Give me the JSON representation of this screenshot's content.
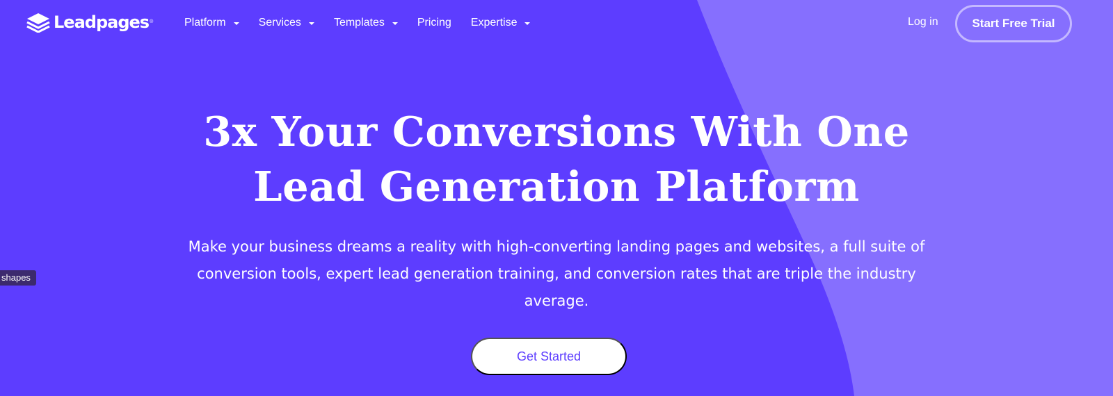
{
  "brand": {
    "name": "Leadpages",
    "registered_mark": "®",
    "logo_icon": "stacked-layers-icon"
  },
  "colors": {
    "background": "#5d3dff",
    "background_shape": "#866ffe",
    "text": "#ffffff",
    "trial_border": "#c4b8ff",
    "cta_background": "#ffffff",
    "cta_text": "#5d3dff",
    "tooltip_background": "#3c2a6e"
  },
  "nav": {
    "items": [
      {
        "label": "Platform",
        "has_dropdown": true
      },
      {
        "label": "Services",
        "has_dropdown": true
      },
      {
        "label": "Templates",
        "has_dropdown": true
      },
      {
        "label": "Pricing",
        "has_dropdown": false
      },
      {
        "label": "Expertise",
        "has_dropdown": true
      }
    ],
    "login_label": "Log in",
    "trial_label": "Start Free Trial"
  },
  "hero": {
    "title_line1": "3x Your Conversions With One",
    "title_line2": "Lead Generation Platform",
    "subtitle": "Make your business dreams a reality with high-converting landing pages and websites, a full suite of conversion tools, expert lead generation training, and conversion rates that are triple the industry average.",
    "cta_label": "Get Started"
  },
  "tooltip": {
    "text": "shapes"
  }
}
